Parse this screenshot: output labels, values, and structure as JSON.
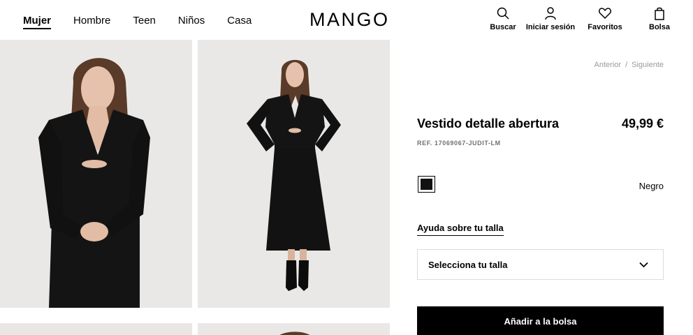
{
  "header": {
    "nav": [
      "Mujer",
      "Hombre",
      "Teen",
      "Niños",
      "Casa"
    ],
    "logo": "MANGO",
    "actions": {
      "search": "Buscar",
      "login": "Iniciar sesión",
      "favorites": "Favoritos",
      "bag": "Bolsa"
    }
  },
  "pager": {
    "prev": "Anterior",
    "sep": "/",
    "next": "Siguiente"
  },
  "product": {
    "name": "Vestido detalle abertura",
    "price": "49,99 €",
    "ref": "REF. 17069067-JUDIT-LM",
    "color": {
      "name": "Negro",
      "hex": "#111111"
    },
    "size_help": "Ayuda sobre tu talla",
    "size_placeholder": "Selecciona tu talla",
    "add_to_bag": "Añadir a la bolsa"
  },
  "icons": [
    "search-icon",
    "user-icon",
    "heart-icon",
    "bag-icon",
    "chevron-down-icon"
  ],
  "colors": {
    "accent": "#000000",
    "photo_bg": "#e8e7e5",
    "muted_text": "#9a9a9a"
  }
}
